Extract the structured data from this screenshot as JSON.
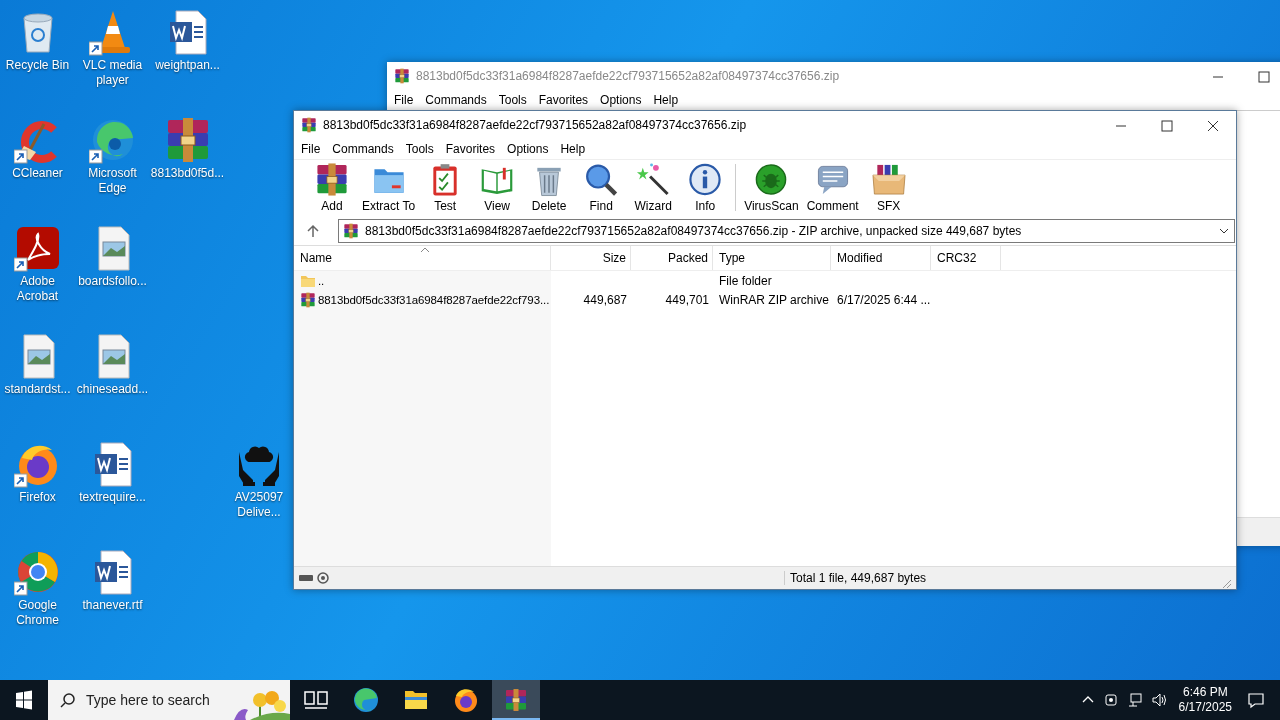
{
  "desktop_icons": [
    {
      "label": "Recycle Bin",
      "kind": "recycle",
      "shortcut": false
    },
    {
      "label": "VLC media player",
      "kind": "vlc",
      "shortcut": true
    },
    {
      "label": "weightpan...",
      "kind": "word",
      "shortcut": false
    },
    {
      "label": "CCleaner",
      "kind": "ccleaner",
      "shortcut": true
    },
    {
      "label": "Microsoft Edge",
      "kind": "edge",
      "shortcut": true
    },
    {
      "label": "8813bd0f5d...",
      "kind": "winrar",
      "shortcut": false
    },
    {
      "label": "Adobe Acrobat",
      "kind": "acrobat",
      "shortcut": true
    },
    {
      "label": "boardsfollo...",
      "kind": "image",
      "shortcut": false
    },
    {
      "label": "standardst...",
      "kind": "image",
      "shortcut": false
    },
    {
      "label": "chineseadd...",
      "kind": "image",
      "shortcut": false
    },
    {
      "label": "Firefox",
      "kind": "firefox",
      "shortcut": true
    },
    {
      "label": "textrequire...",
      "kind": "word",
      "shortcut": false
    },
    {
      "label": "AV25097 Delive...",
      "kind": "hands",
      "shortcut": false
    },
    {
      "label": "Google Chrome",
      "kind": "chrome",
      "shortcut": true
    },
    {
      "label": "thanever.rtf",
      "kind": "word",
      "shortcut": false
    }
  ],
  "back_window": {
    "title": "8813bd0f5dc33f31a6984f8287aefde22cf793715652a82af08497374cc37656.zip",
    "menu": [
      "File",
      "Commands",
      "Tools",
      "Favorites",
      "Options",
      "Help"
    ]
  },
  "window": {
    "title": "8813bd0f5dc33f31a6984f8287aefde22cf793715652a82af08497374cc37656.zip",
    "menu": [
      "File",
      "Commands",
      "Tools",
      "Favorites",
      "Options",
      "Help"
    ],
    "toolbar": [
      [
        {
          "label": "Add",
          "kind": "add"
        },
        {
          "label": "Extract To",
          "kind": "extract"
        },
        {
          "label": "Test",
          "kind": "test"
        },
        {
          "label": "View",
          "kind": "view"
        },
        {
          "label": "Delete",
          "kind": "delete"
        },
        {
          "label": "Find",
          "kind": "find"
        },
        {
          "label": "Wizard",
          "kind": "wizard"
        },
        {
          "label": "Info",
          "kind": "info"
        }
      ],
      [
        {
          "label": "VirusScan",
          "kind": "virus"
        },
        {
          "label": "Comment",
          "kind": "comment"
        },
        {
          "label": "SFX",
          "kind": "sfx"
        }
      ]
    ],
    "address": "8813bd0f5dc33f31a6984f8287aefde22cf793715652a82af08497374cc37656.zip - ZIP archive, unpacked size 449,687 bytes",
    "columns": [
      {
        "label": "Name",
        "sorted": true
      },
      {
        "label": "Size",
        "sorted": false
      },
      {
        "label": "Packed",
        "sorted": false
      },
      {
        "label": "Type",
        "sorted": false
      },
      {
        "label": "Modified",
        "sorted": false
      },
      {
        "label": "CRC32",
        "sorted": false
      }
    ],
    "rows": [
      {
        "kind": "folder",
        "cells": [
          "..",
          "",
          "",
          "File folder",
          "",
          ""
        ]
      },
      {
        "kind": "archive",
        "cells": [
          "8813bd0f5dc33f31a6984f8287aefde22cf793...",
          "449,687",
          "449,701",
          "WinRAR ZIP archive",
          "6/17/2025 6:44 ...",
          ""
        ]
      }
    ],
    "status": "Total 1 file, 449,687 bytes"
  },
  "taskbar": {
    "search_placeholder": "Type here to search",
    "apps": [
      {
        "kind": "taskview",
        "active": false
      },
      {
        "kind": "edge",
        "active": false
      },
      {
        "kind": "explorer",
        "active": false
      },
      {
        "kind": "firefox",
        "active": false
      },
      {
        "kind": "winrar",
        "active": true
      }
    ],
    "time": "6:46 PM",
    "date": "6/17/2025"
  }
}
